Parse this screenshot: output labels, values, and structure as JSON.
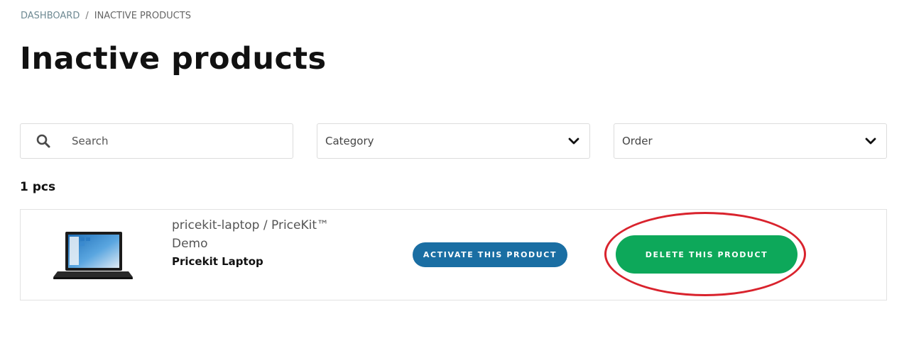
{
  "breadcrumb": {
    "parent": "DASHBOARD",
    "separator": "/",
    "current": "INACTIVE PRODUCTS"
  },
  "page": {
    "title": "Inactive products"
  },
  "filters": {
    "search": {
      "placeholder": "Search",
      "value": ""
    },
    "category": {
      "selected": "Category"
    },
    "order": {
      "selected": "Order"
    }
  },
  "results": {
    "count_label": "1 pcs"
  },
  "products": [
    {
      "name": "pricekit-laptop / PriceKit™ Demo",
      "subtitle": "Pricekit Laptop",
      "activate_label": "ACTIVATE THIS PRODUCT",
      "delete_label": "DELETE THIS PRODUCT"
    }
  ],
  "colors": {
    "activate_button": "#1a6ea3",
    "delete_button": "#0da85a",
    "highlight_annotation": "#d9232d"
  },
  "icons": [
    "search-icon",
    "chevron-down-icon",
    "laptop-thumbnail"
  ]
}
